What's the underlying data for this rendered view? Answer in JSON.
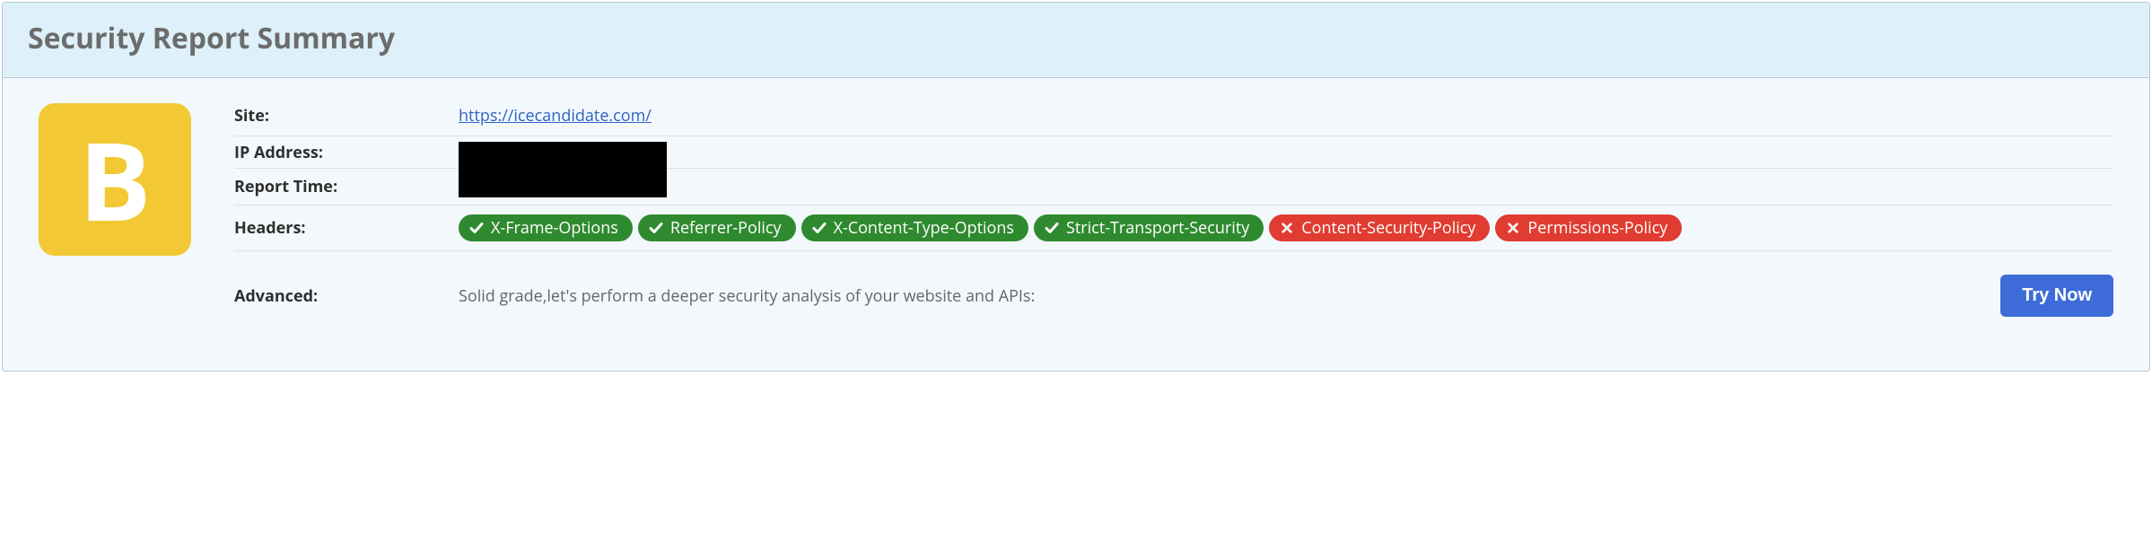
{
  "title": "Security Report Summary",
  "grade": "B",
  "grade_color": "#f2c935",
  "rows": {
    "site": {
      "label": "Site:",
      "url": "https://icecandidate.com/"
    },
    "ip": {
      "label": "IP Address:"
    },
    "report_time": {
      "label": "Report Time:"
    },
    "headers": {
      "label": "Headers:",
      "items": [
        {
          "name": "X-Frame-Options",
          "status": "pass"
        },
        {
          "name": "Referrer-Policy",
          "status": "pass"
        },
        {
          "name": "X-Content-Type-Options",
          "status": "pass"
        },
        {
          "name": "Strict-Transport-Security",
          "status": "pass"
        },
        {
          "name": "Content-Security-Policy",
          "status": "fail"
        },
        {
          "name": "Permissions-Policy",
          "status": "fail"
        }
      ]
    },
    "advanced": {
      "label": "Advanced:",
      "text": "Solid grade,let's perform a deeper security analysis of your website and APIs:",
      "button": "Try Now"
    }
  }
}
